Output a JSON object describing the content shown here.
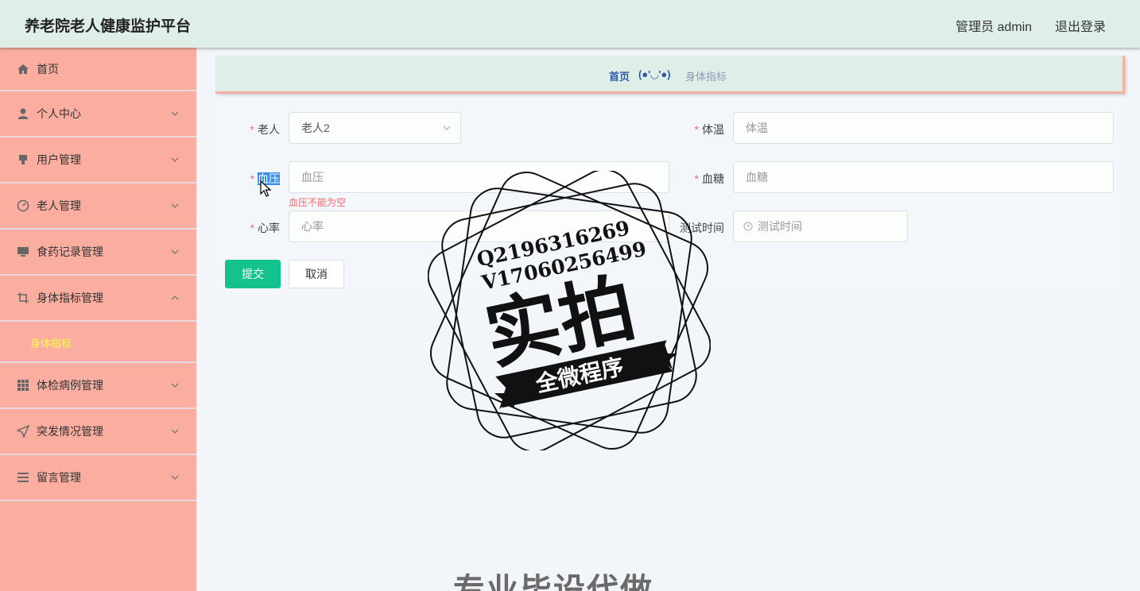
{
  "header": {
    "title": "养老院老人健康监护平台",
    "admin": "管理员 admin",
    "logout": "退出登录"
  },
  "sidebar": {
    "items": [
      {
        "label": "首页",
        "icon": "home-icon"
      },
      {
        "label": "个人中心",
        "icon": "user-icon"
      },
      {
        "label": "用户管理",
        "icon": "user-manage-icon"
      },
      {
        "label": "老人管理",
        "icon": "gauge-icon"
      },
      {
        "label": "食药记录管理",
        "icon": "monitor-icon"
      },
      {
        "label": "身体指标管理",
        "icon": "crop-icon"
      },
      {
        "label": "体检病例管理",
        "icon": "grid-icon"
      },
      {
        "label": "突发情况管理",
        "icon": "navigation-icon"
      },
      {
        "label": "留言管理",
        "icon": "list-icon"
      }
    ],
    "active_sub": "身体指标"
  },
  "breadcrumb": {
    "home": "首页",
    "face": "(●'◡'●)",
    "current": "身体指标"
  },
  "form": {
    "elder_label": "老人",
    "elder_value": "老人2",
    "temp_label": "体温",
    "temp_placeholder": "体温",
    "bp_label": "血压",
    "bp_placeholder": "血压",
    "bp_error": "血压不能为空",
    "sugar_label": "血糖",
    "sugar_placeholder": "血糖",
    "hr_label": "心率",
    "hr_placeholder": "心率",
    "time_label": "测试时间",
    "time_placeholder": "测试时间",
    "submit": "提交",
    "cancel": "取消"
  },
  "watermark": {
    "line1": "Q2196316269",
    "line2": "V17060256499",
    "big": "实拍",
    "ribbon": "全微程序",
    "bottom": "专业毕设代做"
  },
  "colors": {
    "sidebar": "#fbaea0",
    "topbar": "#dfefe8",
    "submit": "#13c28d",
    "active_sub": "#f7ff3c",
    "required": "#f56c6c"
  }
}
